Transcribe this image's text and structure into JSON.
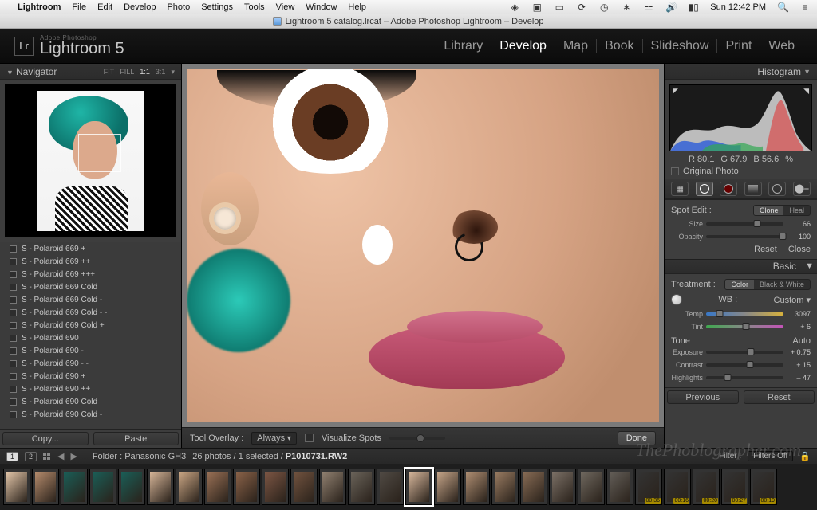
{
  "mac": {
    "app": "Lightroom",
    "menus": [
      "File",
      "Edit",
      "Develop",
      "Photo",
      "Settings",
      "Tools",
      "View",
      "Window",
      "Help"
    ],
    "clock": "Sun 12:42 PM",
    "title": "Lightroom 5 catalog.lrcat – Adobe Photoshop Lightroom – Develop"
  },
  "header": {
    "brand_small": "Adobe Photoshop",
    "brand": "Lightroom 5",
    "modules": [
      "Library",
      "Develop",
      "Map",
      "Book",
      "Slideshow",
      "Print",
      "Web"
    ],
    "active_module": "Develop"
  },
  "navigator": {
    "title": "Navigator",
    "zoom_opts": [
      "FIT",
      "FILL",
      "1:1",
      "3:1"
    ]
  },
  "presets": [
    "S - Polaroid 669 +",
    "S - Polaroid 669 ++",
    "S - Polaroid 669 +++",
    "S - Polaroid 669 Cold",
    "S - Polaroid 669 Cold -",
    "S - Polaroid 669 Cold - -",
    "S - Polaroid 669 Cold +",
    "S - Polaroid 690",
    "S - Polaroid 690 -",
    "S - Polaroid 690 - -",
    "S - Polaroid 690 +",
    "S - Polaroid 690 ++",
    "S - Polaroid 690 Cold",
    "S - Polaroid 690 Cold -"
  ],
  "left_buttons": {
    "copy": "Copy...",
    "paste": "Paste"
  },
  "toolbar": {
    "overlay_lbl": "Tool Overlay :",
    "overlay_val": "Always",
    "visualize": "Visualize Spots",
    "done": "Done"
  },
  "right": {
    "histogram": "Histogram",
    "rgb": {
      "r": "R  80.1",
      "g": "G  67.9",
      "b": "B  56.6",
      "pct": "%"
    },
    "original": "Original Photo",
    "spot": {
      "title": "Spot Edit :",
      "clone": "Clone",
      "heal": "Heal",
      "size_lbl": "Size",
      "size_val": "66",
      "opacity_lbl": "Opacity",
      "opacity_val": "100",
      "reset": "Reset",
      "close": "Close"
    },
    "basic": {
      "title": "Basic",
      "treatment_lbl": "Treatment :",
      "color": "Color",
      "bw": "Black & White",
      "wb_lbl": "WB :",
      "wb_val": "Custom",
      "temp_lbl": "Temp",
      "temp_val": "3097",
      "tint_lbl": "Tint",
      "tint_val": "+ 6",
      "tone_lbl": "Tone",
      "auto": "Auto",
      "exposure_lbl": "Exposure",
      "exposure_val": "+ 0.75",
      "contrast_lbl": "Contrast",
      "contrast_val": "+ 15",
      "highlights_lbl": "Highlights",
      "highlights_val": "– 47"
    },
    "buttons": {
      "previous": "Previous",
      "reset": "Reset"
    }
  },
  "info": {
    "pages": [
      "1",
      "2"
    ],
    "folder_lbl": "Folder : ",
    "folder": "Panasonic GH3",
    "stats": "26 photos / 1 selected /",
    "filename": "P1010731.RW2",
    "filter_lbl": "Filter :",
    "filter_val": "Filters Off"
  },
  "filmstrip_badges": [
    "00:36",
    "00:16",
    "00:20",
    "00:27",
    "00:19"
  ],
  "watermark": "ThePhoblographer.com"
}
